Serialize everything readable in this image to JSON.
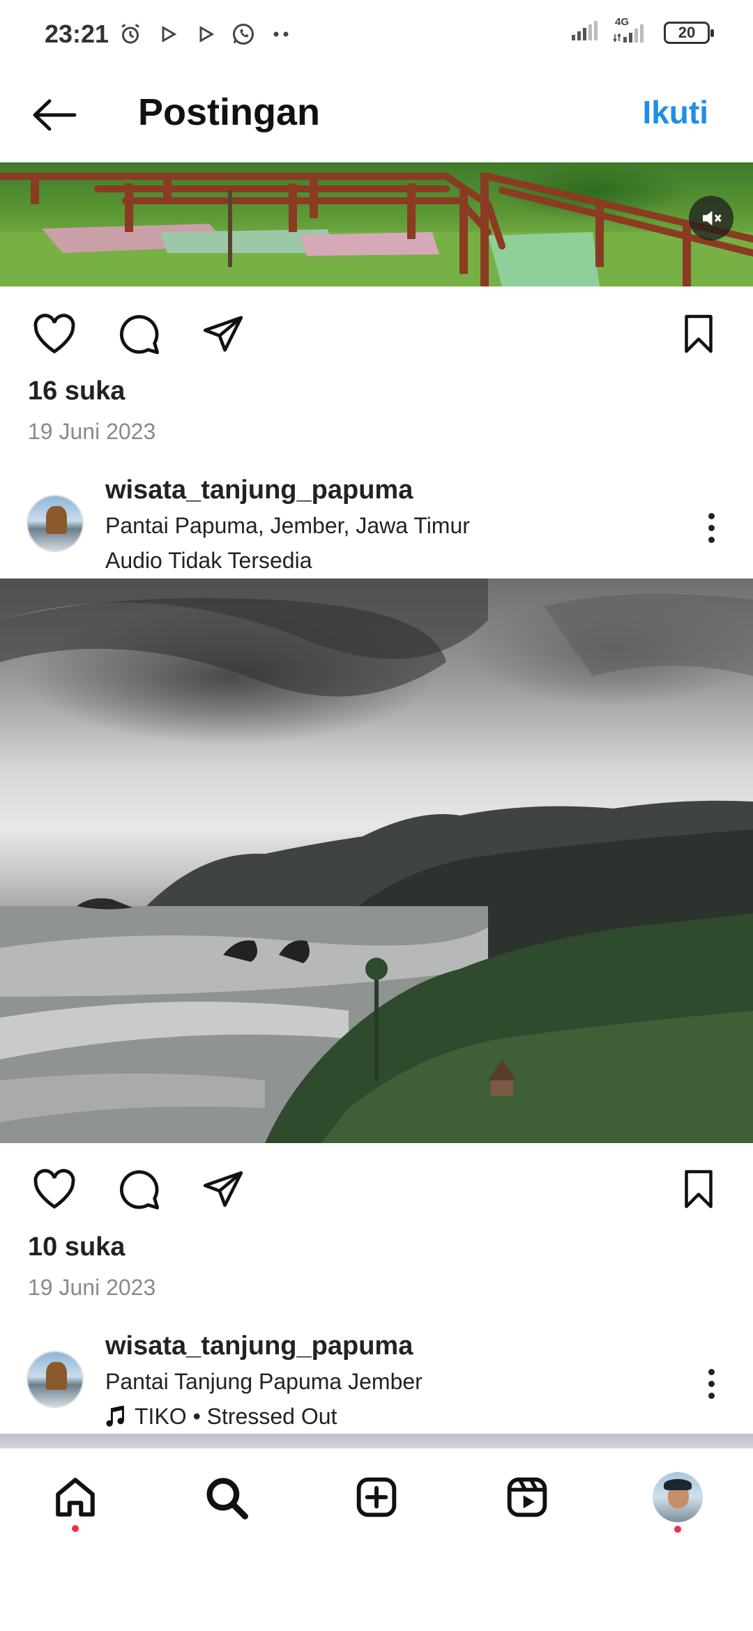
{
  "status_bar": {
    "time": "23:21",
    "battery": "20",
    "network": "4G",
    "icons": [
      "alarm-icon",
      "play-icon",
      "play-icon",
      "whatsapp-icon",
      "more-dots-icon",
      "signal-icon",
      "signal-4g-icon",
      "battery-icon"
    ]
  },
  "header": {
    "title": "Postingan",
    "follow_label": "Ikuti",
    "accent_color": "#1e8fe6"
  },
  "posts": [
    {
      "likes": "16 suka",
      "date": "19 Juni 2023"
    },
    {
      "username": "wisata_tanjung_papuma",
      "location": "Pantai Papuma, Jember, Jawa Timur",
      "audio": "Audio Tidak Tersedia",
      "likes": "10 suka",
      "date": "19 Juni 2023"
    },
    {
      "username": "wisata_tanjung_papuma",
      "location": "Pantai Tanjung Papuma Jember",
      "audio": "TIKO • Stressed Out"
    }
  ],
  "bottom_nav": {
    "items": [
      "home-icon",
      "search-icon",
      "create-icon",
      "reels-icon",
      "profile-avatar"
    ],
    "notification_color": "#ed2f4a"
  }
}
